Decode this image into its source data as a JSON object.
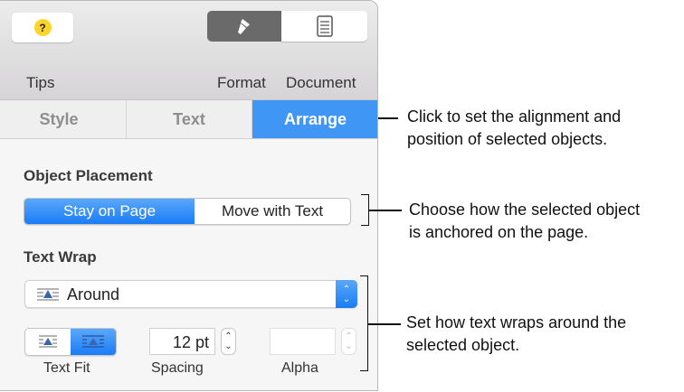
{
  "toolbar": {
    "tips": "Tips",
    "tips_glyph": "?",
    "format": "Format",
    "document": "Document"
  },
  "tabs": [
    {
      "label": "Style"
    },
    {
      "label": "Text"
    },
    {
      "label": "Arrange",
      "active": true
    }
  ],
  "placement": {
    "heading": "Object Placement",
    "options": [
      "Stay on Page",
      "Move with Text"
    ],
    "selected": "Stay on Page"
  },
  "wrap": {
    "heading": "Text Wrap",
    "value": "Around",
    "text_fit_label": "Text Fit",
    "spacing_label": "Spacing",
    "spacing_value": "12 pt",
    "alpha_label": "Alpha",
    "alpha_value": ""
  },
  "callouts": [
    {
      "line1": "Click to set the alignment and",
      "line2": "position of selected objects."
    },
    {
      "line1": "Choose how the selected object",
      "line2": "is anchored on the page."
    },
    {
      "line1": "Set how text wraps around the",
      "line2": "selected object."
    }
  ],
  "colors": {
    "accent": "#3f96f5",
    "tips_yellow": "#fbd52c"
  }
}
